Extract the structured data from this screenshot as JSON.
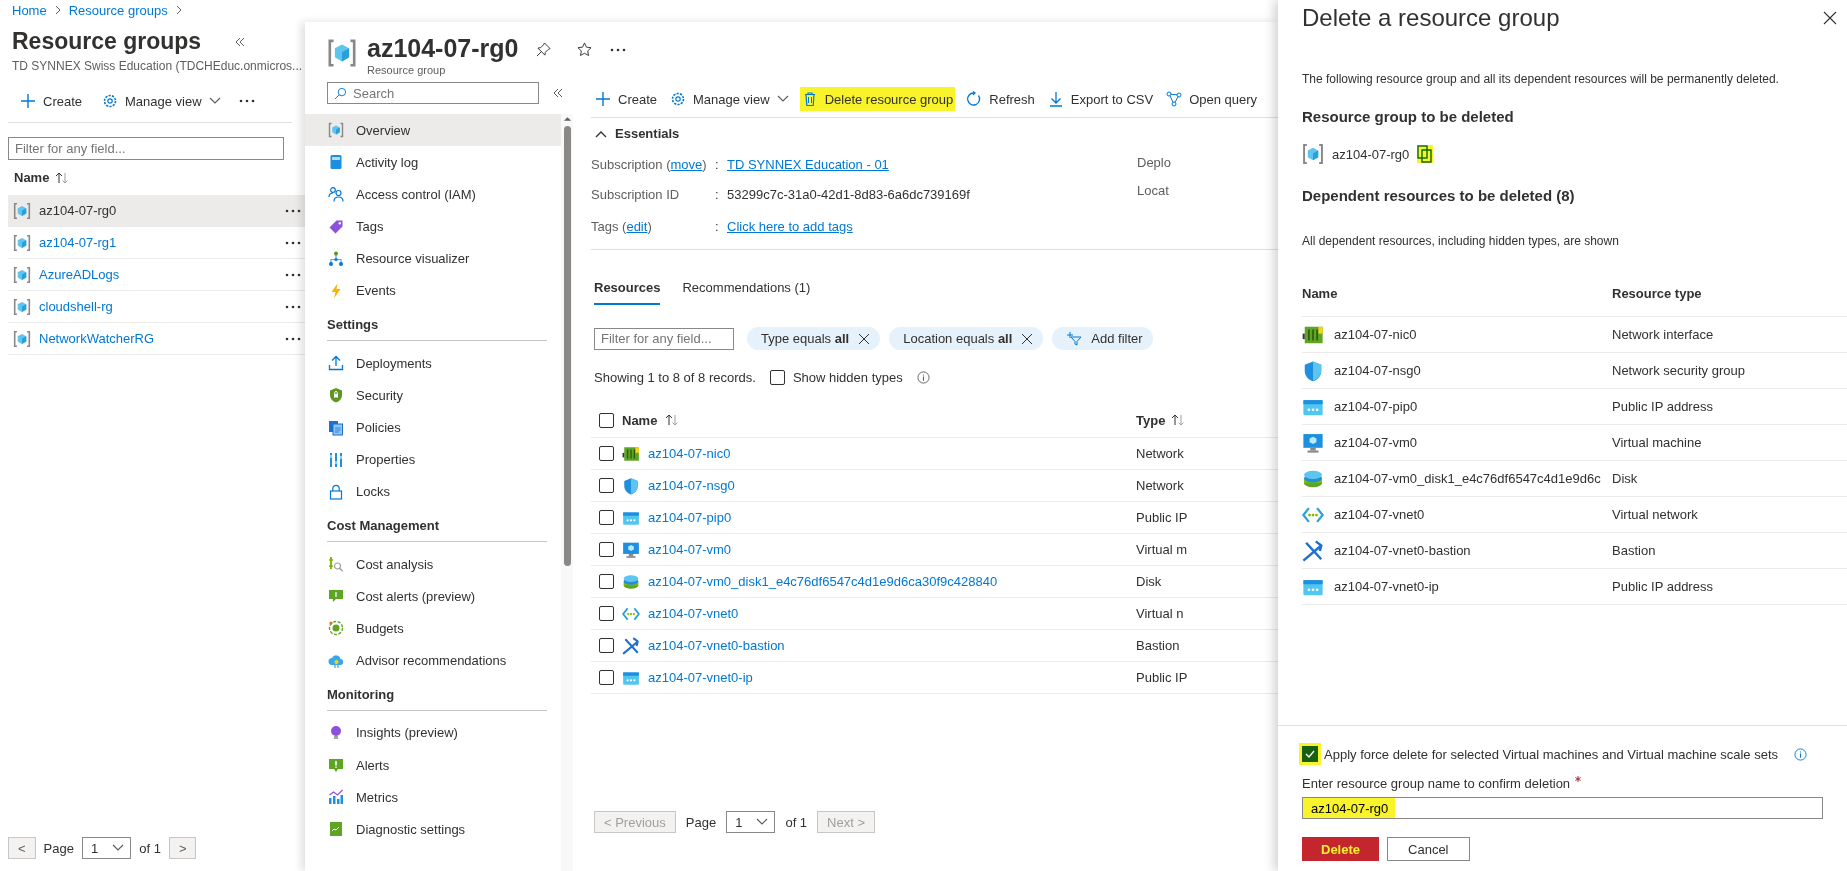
{
  "breadcrumb": [
    {
      "label": "Home"
    },
    {
      "label": "Resource groups"
    }
  ],
  "resource_groups": {
    "title": "Resource groups",
    "subtitle": "TD SYNNEX Swiss Education (TDCHEduc.onmicros...",
    "toolbar": [
      {
        "label": "Create",
        "kind": "create"
      },
      {
        "label": "Manage view",
        "kind": "manage"
      }
    ],
    "filter": {
      "placeholder": "Filter for any field..."
    },
    "column": "Name",
    "items": [
      {
        "name": "az104-07-rg0",
        "selected": true
      },
      {
        "name": "az104-07-rg1",
        "selected": false
      },
      {
        "name": "AzureADLogs",
        "selected": false
      },
      {
        "name": "cloudshell-rg",
        "selected": false
      },
      {
        "name": "NetworkWatcherRG",
        "selected": false
      }
    ],
    "pagination": {
      "prev": "<",
      "page_label": "Page",
      "page": "1",
      "of": "of 1",
      "next": ">"
    }
  },
  "resource_group": {
    "name": "az104-07-rg0",
    "type": "Resource group",
    "search": {
      "placeholder": "Search"
    },
    "nav": [
      {
        "items": [
          {
            "label": "Overview",
            "kind": "overview",
            "selected": true
          },
          {
            "label": "Activity log",
            "kind": "activity-log",
            "selected": false
          },
          {
            "label": "Access control (IAM)",
            "kind": "iam",
            "selected": false
          },
          {
            "label": "Tags",
            "kind": "tags",
            "selected": false
          },
          {
            "label": "Resource visualizer",
            "kind": "visualizer",
            "selected": false
          },
          {
            "label": "Events",
            "kind": "events",
            "selected": false
          }
        ]
      },
      {
        "heading": "Settings",
        "items": [
          {
            "label": "Deployments",
            "kind": "deployments",
            "selected": false
          },
          {
            "label": "Security",
            "kind": "security",
            "selected": false
          },
          {
            "label": "Policies",
            "kind": "policies",
            "selected": false
          },
          {
            "label": "Properties",
            "kind": "properties",
            "selected": false
          },
          {
            "label": "Locks",
            "kind": "locks",
            "selected": false
          }
        ]
      },
      {
        "heading": "Cost Management",
        "items": [
          {
            "label": "Cost analysis",
            "kind": "cost-analysis",
            "selected": false
          },
          {
            "label": "Cost alerts (preview)",
            "kind": "cost-alerts",
            "selected": false
          },
          {
            "label": "Budgets",
            "kind": "budgets",
            "selected": false
          },
          {
            "label": "Advisor recommendations",
            "kind": "advisor",
            "selected": false
          }
        ]
      },
      {
        "heading": "Monitoring",
        "items": [
          {
            "label": "Insights (preview)",
            "kind": "insights",
            "selected": false
          },
          {
            "label": "Alerts",
            "kind": "alerts",
            "selected": false
          },
          {
            "label": "Metrics",
            "kind": "metrics",
            "selected": false
          },
          {
            "label": "Diagnostic settings",
            "kind": "diagnostics",
            "selected": false
          }
        ]
      }
    ],
    "toolbar": [
      {
        "label": "Create",
        "kind": "create",
        "highlighted": false
      },
      {
        "label": "Manage view",
        "kind": "manage",
        "highlighted": false
      },
      {
        "label": "Delete resource group",
        "kind": "delete",
        "highlighted": true
      },
      {
        "label": "Refresh",
        "kind": "refresh",
        "highlighted": false
      },
      {
        "label": "Export to CSV",
        "kind": "export",
        "highlighted": false
      },
      {
        "label": "Open query",
        "kind": "query",
        "highlighted": false
      }
    ],
    "essentials": {
      "title": "Essentials",
      "expanded": true,
      "rows": [
        {
          "label": "Subscription (",
          "link": "move",
          "after": ")",
          "sep": ":",
          "value": "TD SYNNEX Education - 01",
          "value_link": true
        },
        {
          "label": "Subscription ID",
          "sep": ":",
          "value": "53299c7c-31a0-42d1-8d83-6a6dc739169f",
          "value_link": false
        },
        {
          "label": "Tags (",
          "link": "edit",
          "after": ")",
          "sep": ":",
          "value": "Click here to add tags",
          "value_link": true
        }
      ],
      "right_labels": [
        "Deplo",
        "Locat"
      ]
    },
    "tabs": [
      {
        "label": "Resources",
        "selected": true
      },
      {
        "label": "Recommendations (1)",
        "selected": false
      }
    ],
    "filter": {
      "placeholder": "Filter for any field..."
    },
    "pills": [
      {
        "text": "Type equals **all**"
      },
      {
        "text": "Location equals **all**"
      }
    ],
    "add_filter": "Add filter",
    "records": "Showing 1 to 8 of 8 records.",
    "show_hidden": {
      "label": "Show hidden types",
      "checked": false
    },
    "select_all": {
      "checked": false
    },
    "columns": [
      "Name",
      "Type"
    ],
    "rows": [
      {
        "name": "az104-07-nic0",
        "type": "Network",
        "kind": "nic",
        "checked": false
      },
      {
        "name": "az104-07-nsg0",
        "type": "Network",
        "kind": "nsg",
        "checked": false
      },
      {
        "name": "az104-07-pip0",
        "type": "Public IP",
        "kind": "pip",
        "checked": false
      },
      {
        "name": "az104-07-vm0",
        "type": "Virtual m",
        "kind": "vm",
        "checked": false
      },
      {
        "name": "az104-07-vm0_disk1_e4c76df6547c4d1e9d6ca30f9c428840",
        "type": "Disk",
        "kind": "disk",
        "checked": false
      },
      {
        "name": "az104-07-vnet0",
        "type": "Virtual n",
        "kind": "vnet",
        "checked": false
      },
      {
        "name": "az104-07-vnet0-bastion",
        "type": "Bastion",
        "kind": "bastion",
        "checked": false
      },
      {
        "name": "az104-07-vnet0-ip",
        "type": "Public IP",
        "kind": "pip",
        "checked": false
      }
    ],
    "pagination": {
      "prev": "< Previous",
      "prev_disabled": true,
      "page_label": "Page",
      "page": "1",
      "of": "of 1",
      "next": "Next >",
      "next_disabled": true
    }
  },
  "delete_panel": {
    "title": "Delete a resource group",
    "intro": "The following resource group and all its dependent resources will be permanently deleted.",
    "group_heading": "Resource group to be deleted",
    "group": {
      "name": "az104-07-rg0",
      "copy_highlighted": true
    },
    "dependents_heading": "Dependent resources to be deleted (8)",
    "note": "All dependent resources, including hidden types, are shown",
    "columns": [
      "Name",
      "Resource type"
    ],
    "rows": [
      {
        "name": "az104-07-nic0",
        "type": "Network interface",
        "kind": "nic"
      },
      {
        "name": "az104-07-nsg0",
        "type": "Network security group",
        "kind": "nsg"
      },
      {
        "name": "az104-07-pip0",
        "type": "Public IP address",
        "kind": "pip"
      },
      {
        "name": "az104-07-vm0",
        "type": "Virtual machine",
        "kind": "vm"
      },
      {
        "name": "az104-07-vm0_disk1_e4c76df6547c4d1e9d6c",
        "type": "Disk",
        "kind": "disk"
      },
      {
        "name": "az104-07-vnet0",
        "type": "Virtual network",
        "kind": "vnet"
      },
      {
        "name": "az104-07-vnet0-bastion",
        "type": "Bastion",
        "kind": "bastion"
      },
      {
        "name": "az104-07-vnet0-ip",
        "type": "Public IP address",
        "kind": "pip"
      }
    ],
    "force_delete": {
      "label": "Apply force delete for selected Virtual machines and Virtual machine scale sets",
      "checked": true,
      "highlighted": true
    },
    "confirm": {
      "label": "Enter resource group name to confirm deletion",
      "required": true,
      "value": "az104-07-rg0",
      "highlighted": true
    },
    "buttons": [
      {
        "label": "Delete",
        "kind": "primary",
        "highlighted": true
      },
      {
        "label": "Cancel",
        "kind": "secondary",
        "highlighted": false
      }
    ]
  }
}
